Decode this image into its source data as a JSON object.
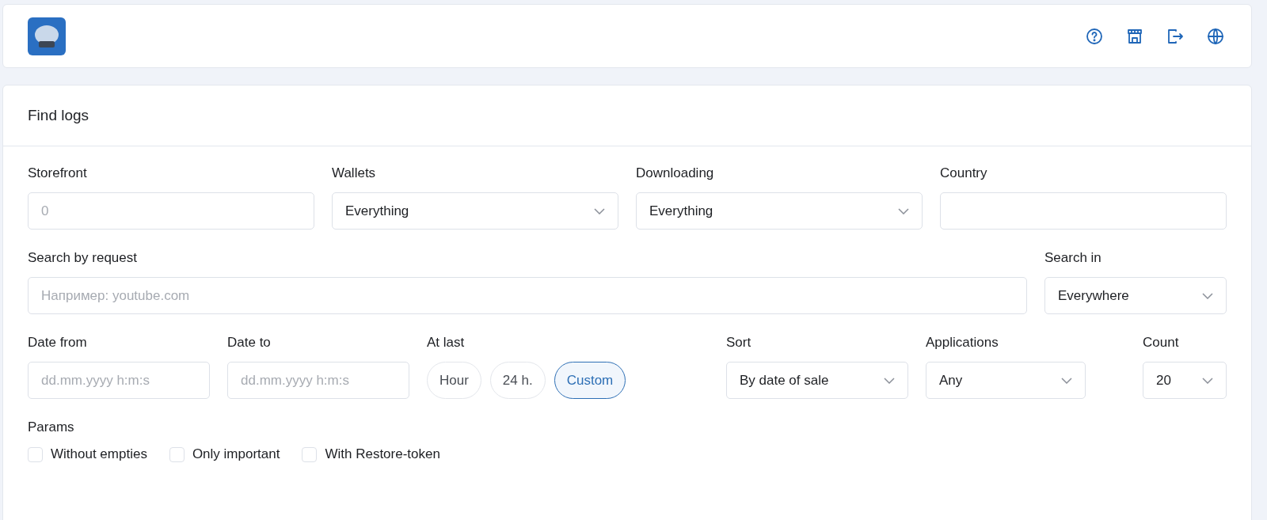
{
  "panel": {
    "title": "Find logs"
  },
  "rows": [
    [
      {
        "label": "Storefront",
        "kind": "input",
        "placeholder": "0"
      },
      {
        "label": "Wallets",
        "kind": "select",
        "value": "Everything"
      },
      {
        "label": "Downloading",
        "kind": "select",
        "value": "Everything"
      },
      {
        "label": "Country",
        "kind": "input"
      }
    ],
    [
      {
        "label": "Search by request",
        "kind": "input",
        "placeholder": "Например: youtube.com"
      },
      {
        "label": "Search in",
        "kind": "select",
        "value": "Everywhere"
      }
    ],
    [
      {
        "label": "Date from",
        "kind": "input",
        "placeholder": "dd.mm.yyyy h:m:s"
      },
      {
        "label": "Date to",
        "kind": "input",
        "placeholder": "dd.mm.yyyy h:m:s"
      },
      {
        "label": "At last",
        "kind": "chips",
        "options": [
          {
            "label": "Hour",
            "selected": false
          },
          {
            "label": "24 h.",
            "selected": false
          },
          {
            "label": "Custom",
            "selected": true
          }
        ]
      },
      {
        "label": "Sort",
        "kind": "select",
        "value": "By date of sale"
      },
      {
        "label": "Applications",
        "kind": "select",
        "value": "Any"
      },
      {
        "label": "Count",
        "kind": "select",
        "value": "20"
      }
    ]
  ],
  "params": {
    "label": "Params",
    "options": [
      {
        "label": "Without empties",
        "checked": false
      },
      {
        "label": "Only important",
        "checked": false
      },
      {
        "label": "With Restore-token",
        "checked": false
      }
    ]
  }
}
